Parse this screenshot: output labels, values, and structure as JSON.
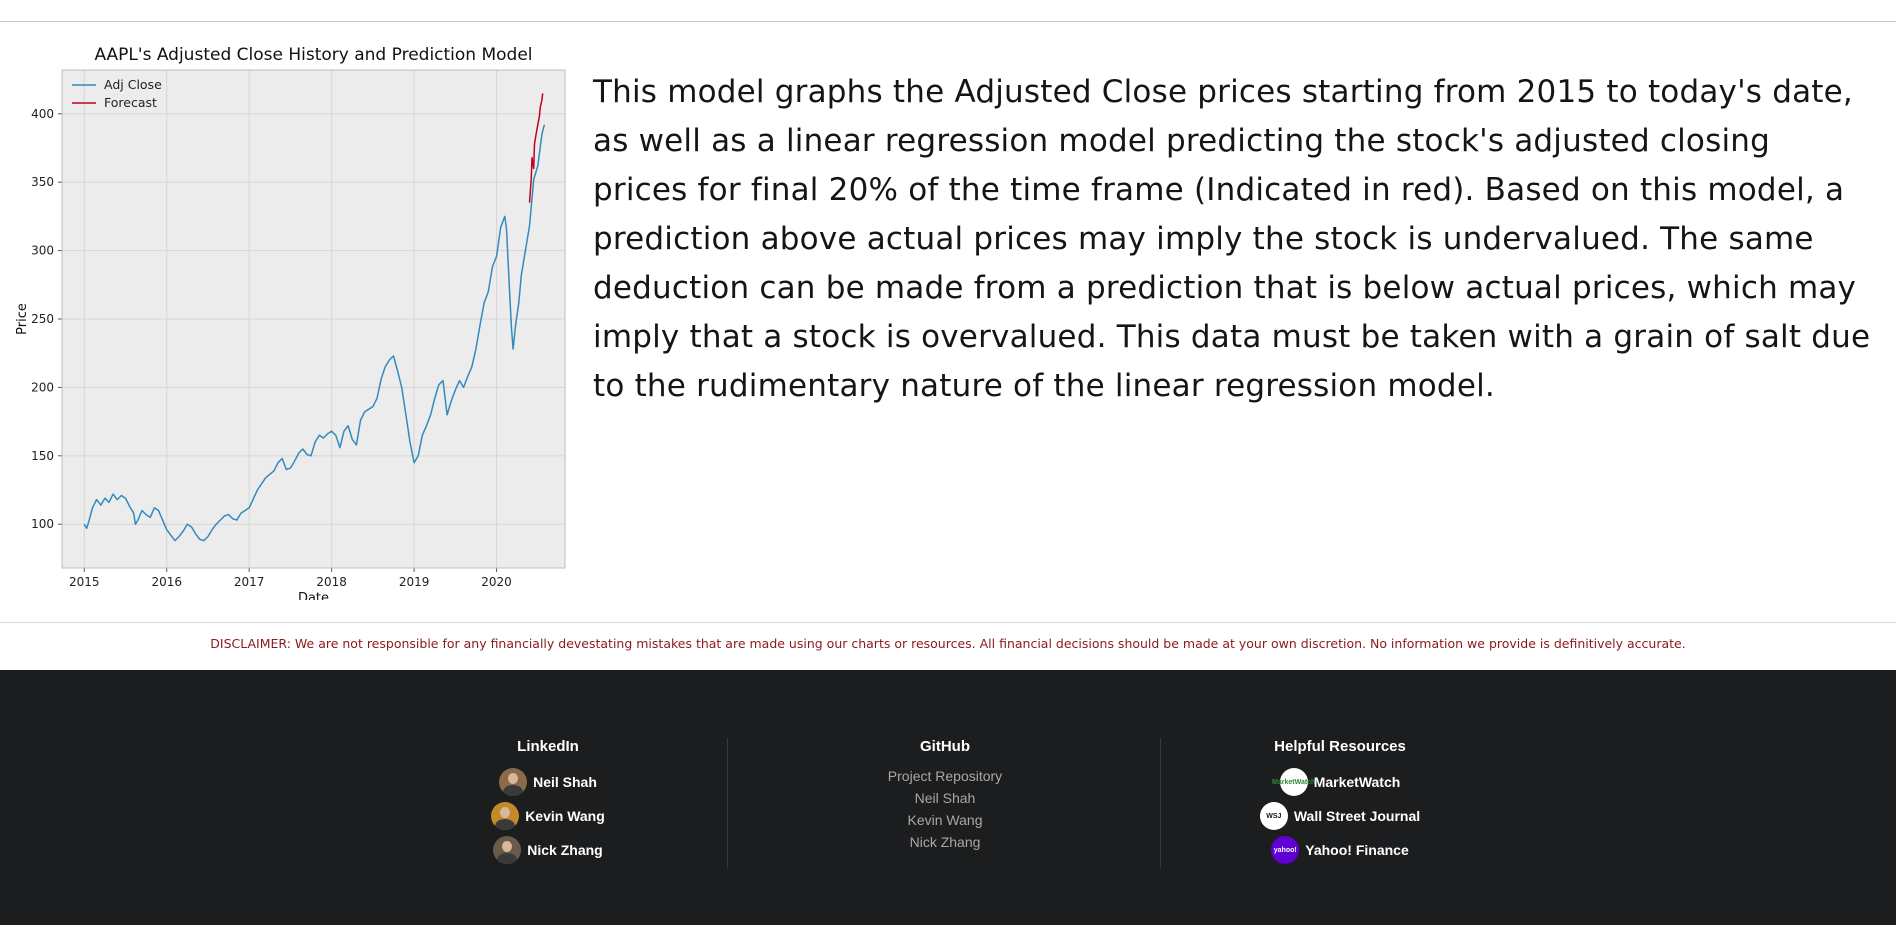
{
  "chart_data": {
    "type": "line",
    "title": "AAPL's Adjusted Close History and Prediction Model",
    "xlabel": "Date",
    "ylabel": "Price",
    "x_ticks": [
      "2015",
      "2016",
      "2017",
      "2018",
      "2019",
      "2020"
    ],
    "y_ticks": [
      100,
      150,
      200,
      250,
      300,
      350,
      400
    ],
    "xlim": [
      2014.73,
      2020.83
    ],
    "ylim": [
      68,
      432
    ],
    "grid": true,
    "legend_position": "top-left",
    "series": [
      {
        "name": "Adj Close",
        "color": "#348abd",
        "points": [
          [
            2015.0,
            100
          ],
          [
            2015.03,
            97
          ],
          [
            2015.06,
            103
          ],
          [
            2015.1,
            112
          ],
          [
            2015.15,
            118
          ],
          [
            2015.2,
            114
          ],
          [
            2015.25,
            119
          ],
          [
            2015.3,
            116
          ],
          [
            2015.35,
            122
          ],
          [
            2015.4,
            118
          ],
          [
            2015.45,
            121
          ],
          [
            2015.5,
            119
          ],
          [
            2015.55,
            113
          ],
          [
            2015.6,
            108
          ],
          [
            2015.62,
            100
          ],
          [
            2015.65,
            103
          ],
          [
            2015.7,
            110
          ],
          [
            2015.75,
            107
          ],
          [
            2015.8,
            105
          ],
          [
            2015.85,
            112
          ],
          [
            2015.9,
            110
          ],
          [
            2015.95,
            103
          ],
          [
            2016.0,
            96
          ],
          [
            2016.05,
            92
          ],
          [
            2016.1,
            88
          ],
          [
            2016.15,
            91
          ],
          [
            2016.2,
            95
          ],
          [
            2016.25,
            100
          ],
          [
            2016.3,
            98
          ],
          [
            2016.35,
            93
          ],
          [
            2016.4,
            89
          ],
          [
            2016.45,
            88
          ],
          [
            2016.5,
            91
          ],
          [
            2016.55,
            96
          ],
          [
            2016.6,
            100
          ],
          [
            2016.65,
            103
          ],
          [
            2016.7,
            106
          ],
          [
            2016.75,
            107
          ],
          [
            2016.8,
            104
          ],
          [
            2016.85,
            103
          ],
          [
            2016.9,
            108
          ],
          [
            2016.95,
            110
          ],
          [
            2017.0,
            112
          ],
          [
            2017.1,
            125
          ],
          [
            2017.2,
            134
          ],
          [
            2017.3,
            139
          ],
          [
            2017.35,
            145
          ],
          [
            2017.4,
            148
          ],
          [
            2017.45,
            140
          ],
          [
            2017.5,
            141
          ],
          [
            2017.55,
            146
          ],
          [
            2017.6,
            152
          ],
          [
            2017.65,
            155
          ],
          [
            2017.7,
            151
          ],
          [
            2017.75,
            150
          ],
          [
            2017.8,
            160
          ],
          [
            2017.85,
            165
          ],
          [
            2017.9,
            163
          ],
          [
            2017.95,
            166
          ],
          [
            2018.0,
            168
          ],
          [
            2018.05,
            165
          ],
          [
            2018.1,
            156
          ],
          [
            2018.15,
            168
          ],
          [
            2018.2,
            172
          ],
          [
            2018.25,
            162
          ],
          [
            2018.3,
            158
          ],
          [
            2018.35,
            176
          ],
          [
            2018.4,
            182
          ],
          [
            2018.45,
            184
          ],
          [
            2018.5,
            186
          ],
          [
            2018.55,
            192
          ],
          [
            2018.6,
            206
          ],
          [
            2018.65,
            215
          ],
          [
            2018.7,
            220
          ],
          [
            2018.75,
            223
          ],
          [
            2018.8,
            212
          ],
          [
            2018.85,
            200
          ],
          [
            2018.9,
            180
          ],
          [
            2018.95,
            160
          ],
          [
            2019.0,
            145
          ],
          [
            2019.05,
            150
          ],
          [
            2019.1,
            165
          ],
          [
            2019.15,
            172
          ],
          [
            2019.2,
            180
          ],
          [
            2019.25,
            192
          ],
          [
            2019.3,
            202
          ],
          [
            2019.35,
            205
          ],
          [
            2019.4,
            180
          ],
          [
            2019.45,
            190
          ],
          [
            2019.5,
            198
          ],
          [
            2019.55,
            205
          ],
          [
            2019.6,
            200
          ],
          [
            2019.65,
            208
          ],
          [
            2019.7,
            215
          ],
          [
            2019.75,
            228
          ],
          [
            2019.8,
            246
          ],
          [
            2019.85,
            262
          ],
          [
            2019.9,
            270
          ],
          [
            2019.95,
            288
          ],
          [
            2020.0,
            296
          ],
          [
            2020.05,
            317
          ],
          [
            2020.1,
            325
          ],
          [
            2020.12,
            316
          ],
          [
            2020.15,
            280
          ],
          [
            2020.18,
            244
          ],
          [
            2020.2,
            228
          ],
          [
            2020.23,
            245
          ],
          [
            2020.27,
            262
          ],
          [
            2020.3,
            282
          ],
          [
            2020.35,
            300
          ],
          [
            2020.4,
            318
          ],
          [
            2020.45,
            352
          ],
          [
            2020.5,
            362
          ],
          [
            2020.55,
            385
          ],
          [
            2020.58,
            392
          ]
        ]
      },
      {
        "name": "Forecast",
        "color": "#c2001f",
        "points": [
          [
            2020.4,
            335
          ],
          [
            2020.42,
            352
          ],
          [
            2020.43,
            368
          ],
          [
            2020.45,
            360
          ],
          [
            2020.46,
            378
          ],
          [
            2020.48,
            385
          ],
          [
            2020.5,
            392
          ],
          [
            2020.52,
            398
          ],
          [
            2020.53,
            405
          ],
          [
            2020.55,
            410
          ],
          [
            2020.56,
            415
          ]
        ]
      }
    ]
  },
  "description": "This model graphs the Adjusted Close prices starting from 2015 to today's date, as well as a linear regression model predicting the stock's adjusted closing prices for final 20% of the time frame (Indicated in red). Based on this model, a prediction above actual prices may imply the stock is undervalued. The same deduction can be made from a prediction that is below actual prices, which may imply that a stock is overvalued. This data must be taken with a grain of salt due to the rudimentary nature of the linear regression model.",
  "disclaimer": "DISCLAIMER: We are not responsible for any financially devestating mistakes that are made using our charts or resources. All financial decisions should be made at your own discretion. No information we provide is definitively accurate.",
  "footer": {
    "linkedin": {
      "title": "LinkedIn",
      "people": [
        {
          "name": "Neil Shah",
          "avatar_color": "#8a6a4a"
        },
        {
          "name": "Kevin Wang",
          "avatar_color": "#c48a2a"
        },
        {
          "name": "Nick Zhang",
          "avatar_color": "#6a5a4a"
        }
      ]
    },
    "github": {
      "title": "GitHub",
      "links": [
        "Project Repository",
        "Neil Shah",
        "Kevin Wang",
        "Nick Zhang"
      ]
    },
    "resources": {
      "title": "Helpful Resources",
      "items": [
        {
          "name": "MarketWatch",
          "logo_text": "MarketWatch",
          "logo_bg": "#ffffff",
          "logo_fg": "#2f8a3b"
        },
        {
          "name": "Wall Street Journal",
          "logo_text": "WSJ",
          "logo_bg": "#ffffff",
          "logo_fg": "#111111"
        },
        {
          "name": "Yahoo! Finance",
          "logo_text": "yahoo!",
          "logo_bg": "#5f01d1",
          "logo_fg": "#ffffff"
        }
      ]
    }
  }
}
